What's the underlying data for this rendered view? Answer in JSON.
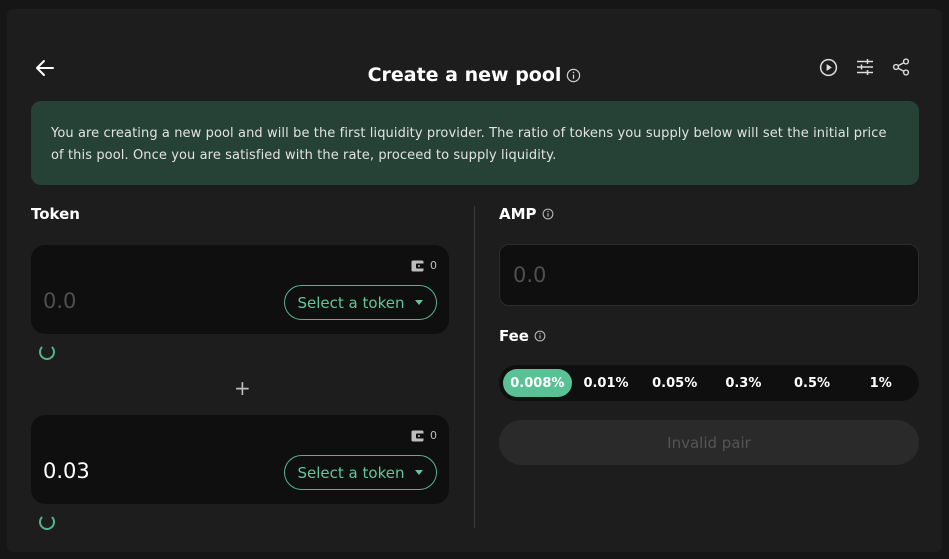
{
  "header": {
    "title": "Create a new pool",
    "back_icon": "arrow-left-icon",
    "actions": [
      "play-circle-icon",
      "sliders-icon",
      "share-icon"
    ]
  },
  "banner": {
    "text": "You are creating a new pool and will be the first liquidity provider. The ratio of tokens you supply below will set the initial price of this pool. Once you are satisfied with the rate, proceed to supply liquidity."
  },
  "tokens": {
    "label": "Token",
    "plus": "+",
    "first": {
      "placeholder": "0.0",
      "balance": "0",
      "select_label": "Select a token"
    },
    "second": {
      "value": "0.03",
      "balance": "0",
      "select_label": "Select a token"
    }
  },
  "amp": {
    "label": "AMP",
    "placeholder": "0.0"
  },
  "fee": {
    "label": "Fee",
    "options": [
      "0.008%",
      "0.01%",
      "0.05%",
      "0.3%",
      "0.5%",
      "1%"
    ],
    "selected": "0.008%"
  },
  "submit": {
    "label": "Invalid pair"
  },
  "colors": {
    "accent": "#5ac197",
    "banner_bg": "#264237",
    "card_bg": "#1d1d1d",
    "input_bg": "#0f0f0f"
  }
}
